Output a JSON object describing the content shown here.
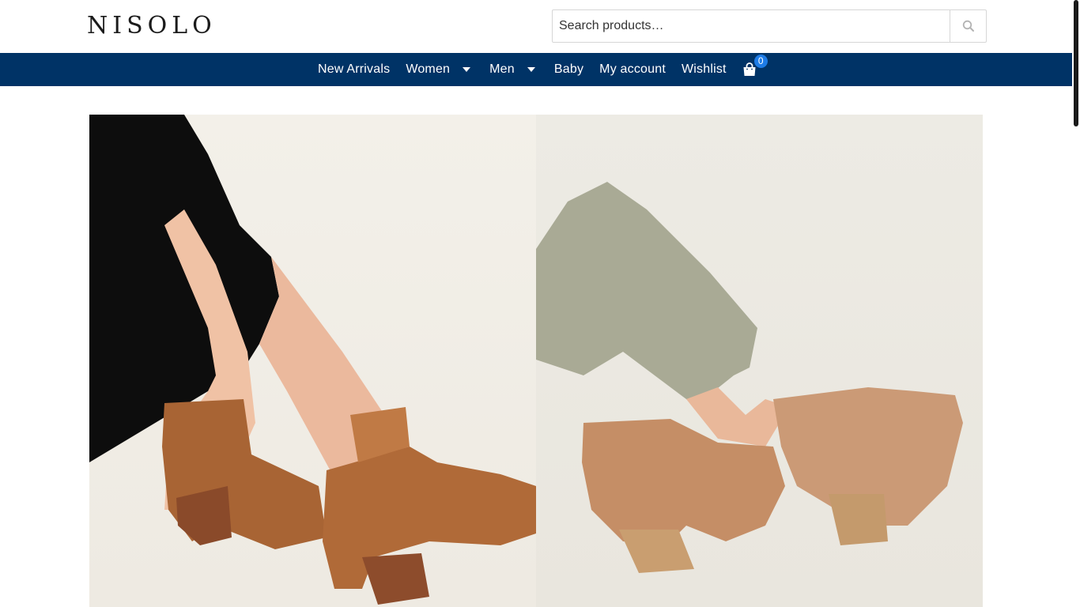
{
  "header": {
    "logo_text": "NISOLO",
    "search": {
      "placeholder": "Search products…",
      "value": "",
      "button_icon": "search-icon"
    }
  },
  "nav": {
    "items": [
      {
        "label": "New Arrivals",
        "has_dropdown": false
      },
      {
        "label": "Women",
        "has_dropdown": true
      },
      {
        "label": "Men",
        "has_dropdown": true
      },
      {
        "label": "Baby",
        "has_dropdown": false
      },
      {
        "label": "My account",
        "has_dropdown": false
      },
      {
        "label": "Wishlist",
        "has_dropdown": false
      }
    ],
    "cart": {
      "icon": "shopping-bag-icon",
      "count": "0"
    }
  },
  "hero": {
    "panels": [
      {
        "subject": "legs-in-black-dress-with-cognac-ankle-boots"
      },
      {
        "subject": "legs-in-sage-jeans-with-tan-ankle-boots"
      }
    ]
  },
  "colors": {
    "nav_background": "#003366",
    "badge": "#1e7ce6",
    "logo": "#1b1b1b"
  }
}
